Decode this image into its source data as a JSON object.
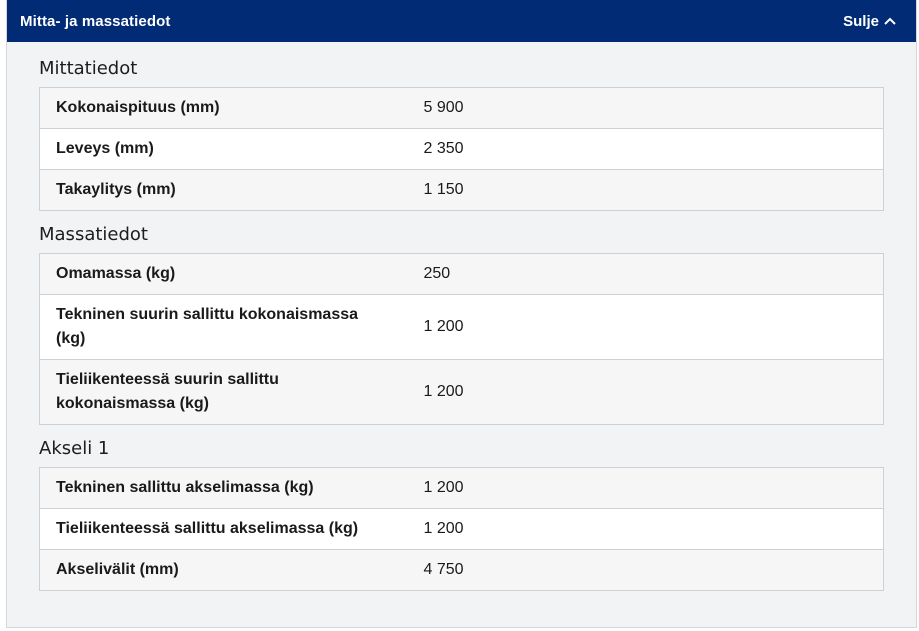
{
  "header": {
    "title": "Mitta- ja massatiedot",
    "close_label": "Sulje"
  },
  "sections": [
    {
      "title": "Mittatiedot",
      "rows": [
        {
          "label": "Kokonaispituus (mm)",
          "value": "5 900"
        },
        {
          "label": "Leveys (mm)",
          "value": "2 350"
        },
        {
          "label": "Takaylitys (mm)",
          "value": "1 150"
        }
      ]
    },
    {
      "title": "Massatiedot",
      "rows": [
        {
          "label": "Omamassa (kg)",
          "value": "250"
        },
        {
          "label": "Tekninen suurin sallittu kokonaismassa (kg)",
          "value": "1 200"
        },
        {
          "label": "Tieliikenteessä suurin sallittu kokonaismassa (kg)",
          "value": "1 200"
        }
      ]
    },
    {
      "title": "Akseli 1",
      "rows": [
        {
          "label": "Tekninen sallittu akselimassa (kg)",
          "value": "1 200"
        },
        {
          "label": "Tieliikenteessä sallittu akselimassa (kg)",
          "value": "1 200"
        },
        {
          "label": "Akselivälit (mm)",
          "value": "4 750"
        }
      ]
    }
  ],
  "colors": {
    "header_bg": "#012c75",
    "panel_bg": "#f2f3f5",
    "border": "#cdd0d4"
  },
  "icons": {
    "close": "chevron-up-icon"
  }
}
